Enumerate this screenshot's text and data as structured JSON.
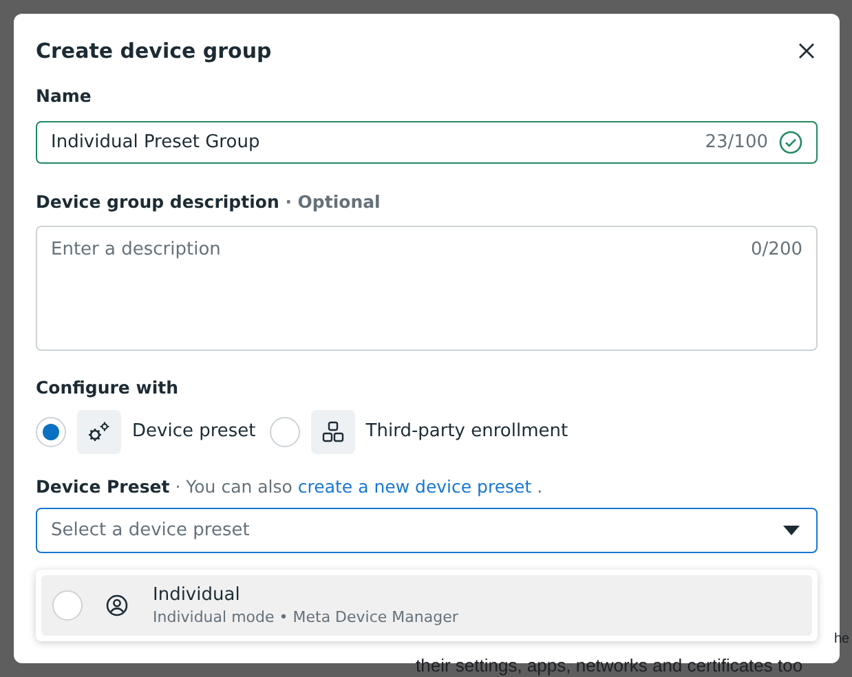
{
  "background_texts": [
    "he",
    "their settings, apps, networks and certificates too"
  ],
  "dialog": {
    "title": "Create device group",
    "name_field": {
      "label": "Name",
      "value": "Individual Preset Group",
      "counter": "23/100",
      "valid": true
    },
    "description_field": {
      "label": "Device group description",
      "optional": "· Optional",
      "placeholder": "Enter a description",
      "counter": "0/200"
    },
    "configure": {
      "label": "Configure with",
      "options": [
        {
          "label": "Device preset",
          "kind": "gears",
          "selected": true
        },
        {
          "label": "Third-party enrollment",
          "kind": "squares",
          "selected": false
        }
      ]
    },
    "preset": {
      "label": "Device Preset",
      "hint": "· You can also",
      "link": "create a new device preset",
      "after": ".",
      "placeholder": "Select a device preset",
      "menu": [
        {
          "title": "Individual",
          "subtitle": "Individual mode • Meta Device Manager",
          "selected": false
        }
      ]
    }
  }
}
